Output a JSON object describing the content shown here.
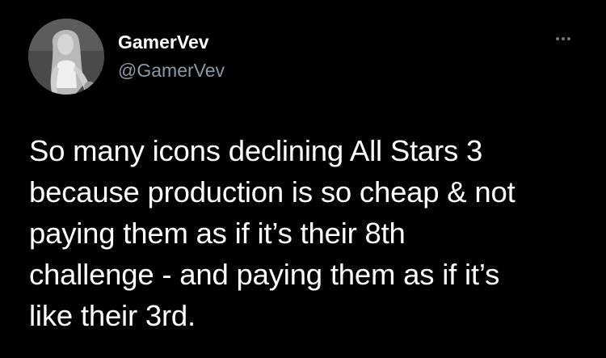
{
  "author": {
    "display_name": "GamerVev",
    "handle": "@GamerVev",
    "avatar_icon": "profile-photo"
  },
  "more_icon": "more-horizontal-icon",
  "tweet": {
    "lines": [
      "So many icons declining All Stars 3",
      "because production is so cheap & not",
      "paying them as if it’s their 8th",
      "challenge - and paying them as if it’s",
      "like their 3rd."
    ]
  },
  "colors": {
    "background": "#000000",
    "text": "#ffffff",
    "secondary_text": "#8b98a5",
    "icon": "#6e767d"
  }
}
